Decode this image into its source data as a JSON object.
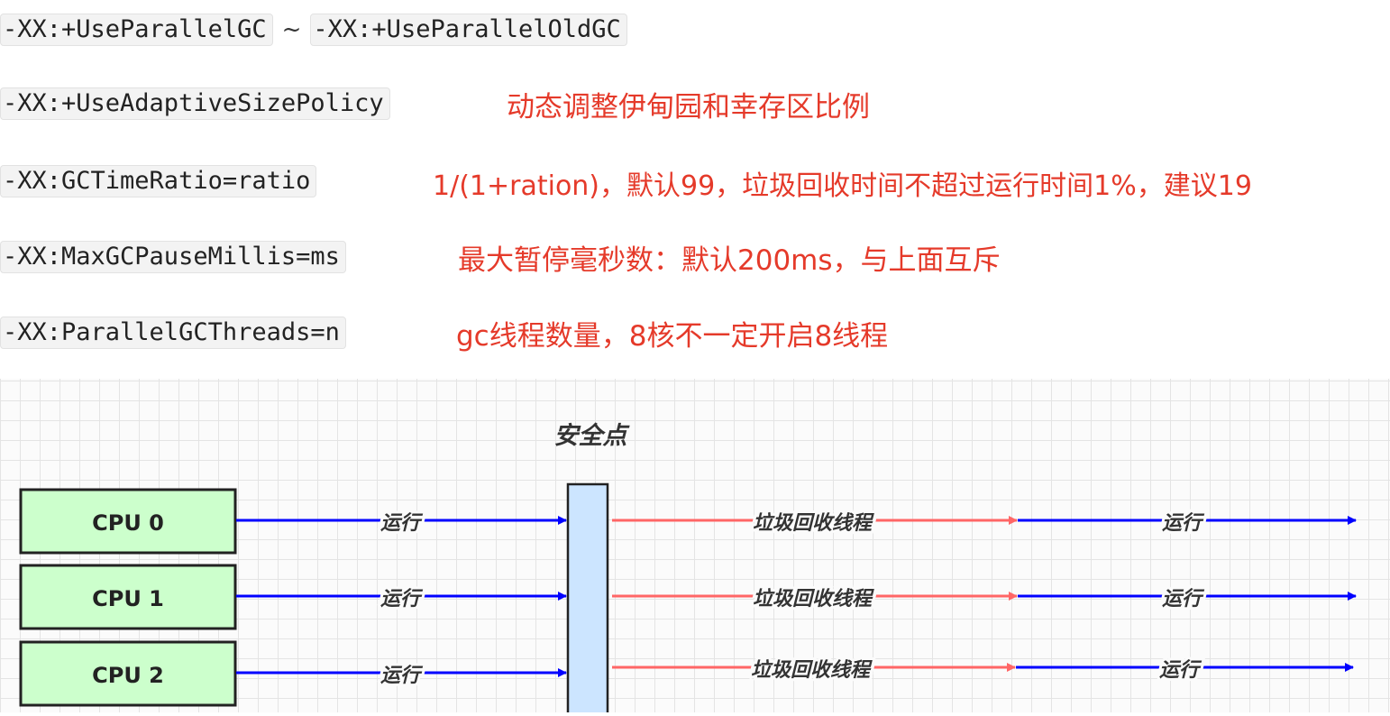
{
  "rows": [
    {
      "codes": [
        "-XX:+UseParallelGC",
        "-XX:+UseParallelOldGC"
      ],
      "separator": "~",
      "note": ""
    },
    {
      "codes": [
        "-XX:+UseAdaptiveSizePolicy"
      ],
      "note": "动态调整伊甸园和幸存区比例"
    },
    {
      "codes": [
        "-XX:GCTimeRatio=ratio"
      ],
      "note": "1/(1+ration)，默认99，垃圾回收时间不超过运行时间1%，建议19"
    },
    {
      "codes": [
        "-XX:MaxGCPauseMillis=ms"
      ],
      "note": "最大暂停毫秒数：默认200ms，与上面互斥"
    },
    {
      "codes": [
        "-XX:ParallelGCThreads=n"
      ],
      "note": "gc线程数量，8核不一定开启8线程"
    }
  ],
  "diagram": {
    "safepoint_label": "安全点",
    "cpus": [
      "CPU 0",
      "CPU 1",
      "CPU 2"
    ],
    "run_label": "运行",
    "gc_label": "垃圾回收线程",
    "colors": {
      "cpu_fill": "#ccffcc",
      "safepoint_fill": "#cce5ff",
      "run_arrow": "#0000ff",
      "gc_arrow": "#ff6666"
    }
  }
}
